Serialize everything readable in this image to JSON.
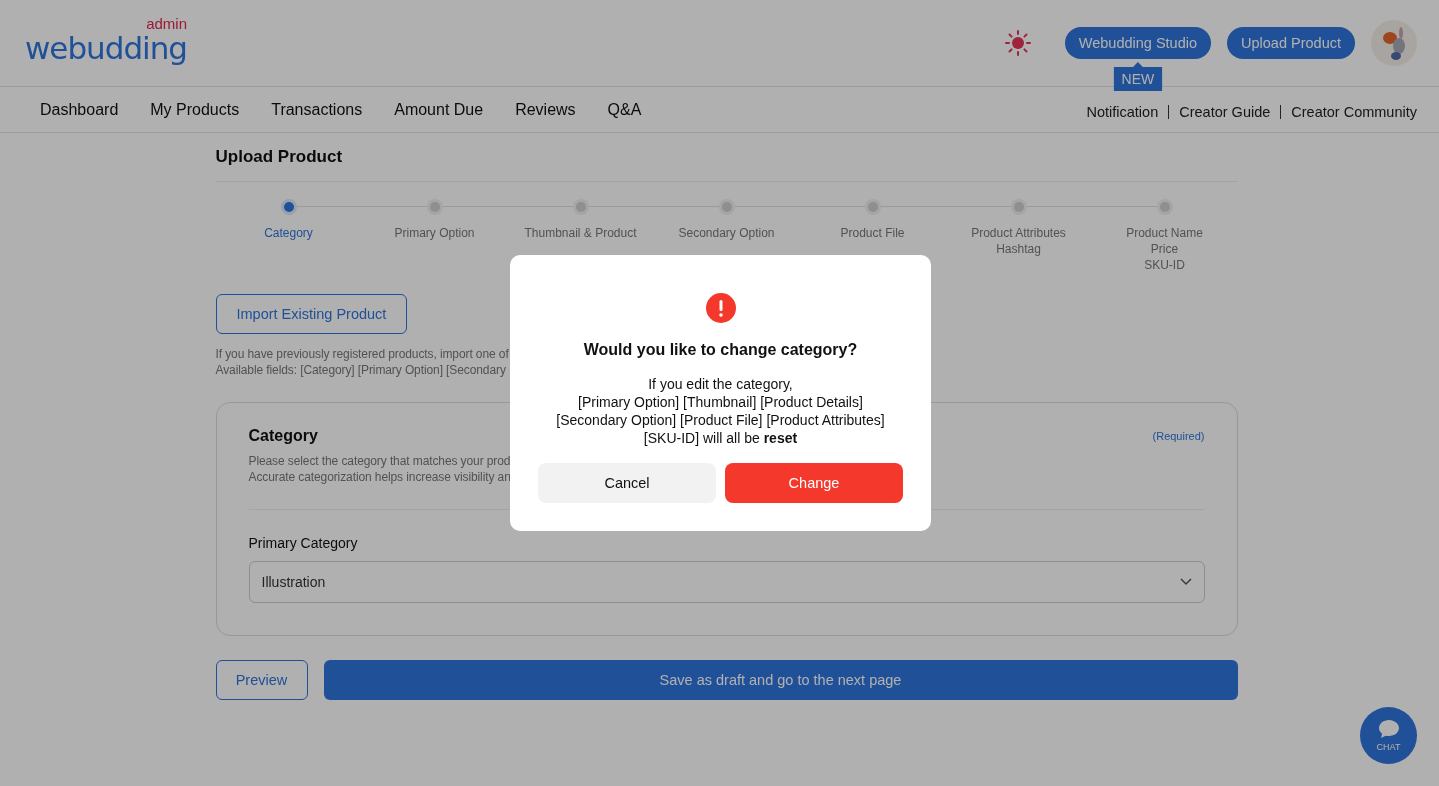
{
  "header": {
    "logo": "webudding",
    "logo_badge": "admin",
    "buttons": [
      "Webudding Studio",
      "Upload Product"
    ],
    "new_tooltip": "NEW"
  },
  "nav": [
    {
      "label": "Dashboard"
    },
    {
      "label": "My Products"
    },
    {
      "label": "Transactions"
    },
    {
      "label": "Amount Due"
    },
    {
      "label": "Reviews"
    },
    {
      "label": "Q&A"
    }
  ],
  "top_links": [
    "Notification",
    "Creator Guide",
    "Creator Community"
  ],
  "page_title": "Upload Product",
  "steps": [
    {
      "lines": [
        "Category"
      ],
      "selected": true
    },
    {
      "lines": [
        "Primary Option"
      ],
      "selected": false
    },
    {
      "lines": [
        "Thumbnail & Product"
      ],
      "selected": false
    },
    {
      "lines": [
        "Secondary Option"
      ],
      "selected": false
    },
    {
      "lines": [
        "Product File"
      ],
      "selected": false
    },
    {
      "lines": [
        "Product Attributes",
        "Hashtag"
      ],
      "selected": false
    },
    {
      "lines": [
        "Product Name",
        "Price",
        "SKU-ID"
      ],
      "selected": false
    }
  ],
  "import_button": "Import Existing Product",
  "import_help": [
    "If you have previously registered products, import one of",
    "Available fields: [Category] [Primary Option] [Secondary"
  ],
  "category_card": {
    "title": "Category",
    "required": "(Required)",
    "help": [
      "Please select the category that matches your prod",
      "Accurate categorization helps increase visibility an"
    ],
    "field_label": "Primary Category",
    "value": "Illustration"
  },
  "footer_buttons": {
    "preview": "Preview",
    "save": "Save as draft and go to the next page"
  },
  "chat": {
    "label": "CHAT"
  },
  "dialog": {
    "title": "Would you like to change category?",
    "message": [
      "If you edit the category,",
      "[Primary Option] [Thumbnail] [Product Details]",
      "[Secondary Option] [Product File] [Product Attributes]",
      "[SKU-ID] will all be **reset**"
    ],
    "cancel": "Cancel",
    "confirm": "Change"
  }
}
